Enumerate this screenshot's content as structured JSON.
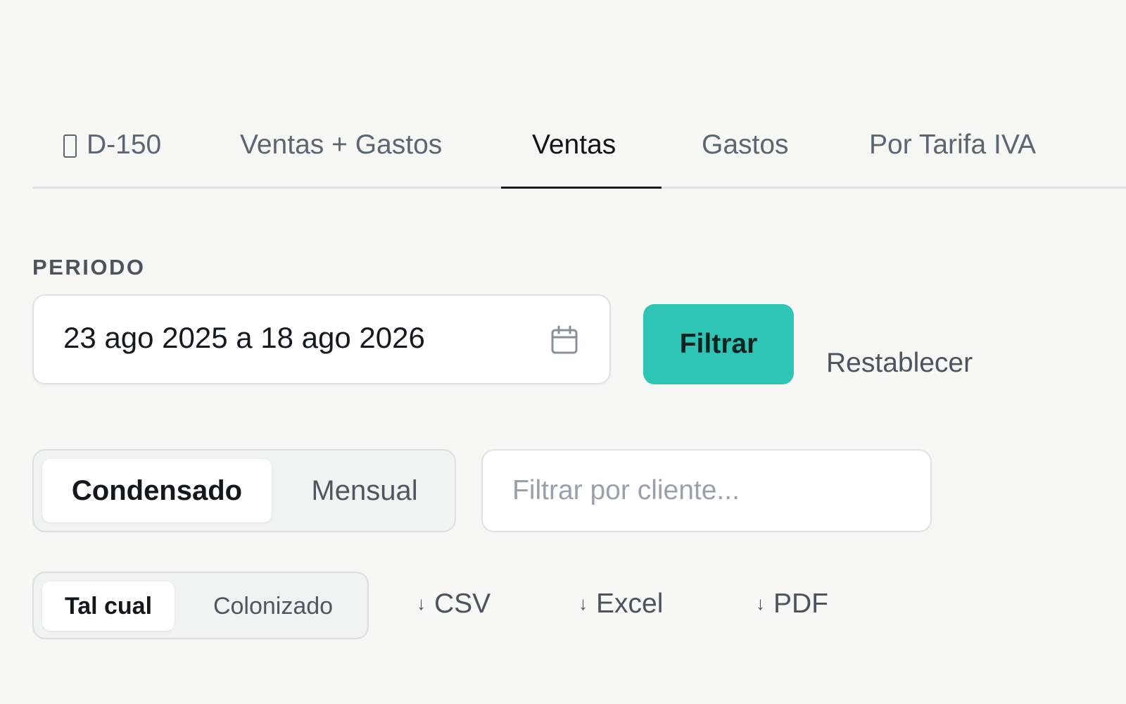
{
  "tabs": [
    {
      "label": "D-150",
      "icon": "document-icon",
      "active": false
    },
    {
      "label": "Ventas + Gastos",
      "active": false
    },
    {
      "label": "Ventas",
      "active": true
    },
    {
      "label": "Gastos",
      "active": false
    },
    {
      "label": "Por Tarifa IVA",
      "active": false
    }
  ],
  "periodo": {
    "label": "PERIODO",
    "value": "23 ago 2025 a 18 ago 2026",
    "icon": "calendar-icon"
  },
  "actions": {
    "filter_label": "Filtrar",
    "reset_label": "Restablecer"
  },
  "view_toggle": {
    "options": [
      "Condensado",
      "Mensual"
    ],
    "selected": "Condensado"
  },
  "client_filter": {
    "placeholder": "Filtrar por cliente...",
    "value": ""
  },
  "mode_toggle": {
    "options": [
      "Tal cual",
      "Colonizado"
    ],
    "selected": "Tal cual"
  },
  "exports": [
    {
      "label": "CSV",
      "icon": "download-arrow-icon"
    },
    {
      "label": "Excel",
      "icon": "download-arrow-icon"
    },
    {
      "label": "PDF",
      "icon": "download-arrow-icon"
    }
  ],
  "colors": {
    "accent": "#2ec4b6",
    "background": "#f7f7f6",
    "active_tab_underline": "#16191d"
  }
}
